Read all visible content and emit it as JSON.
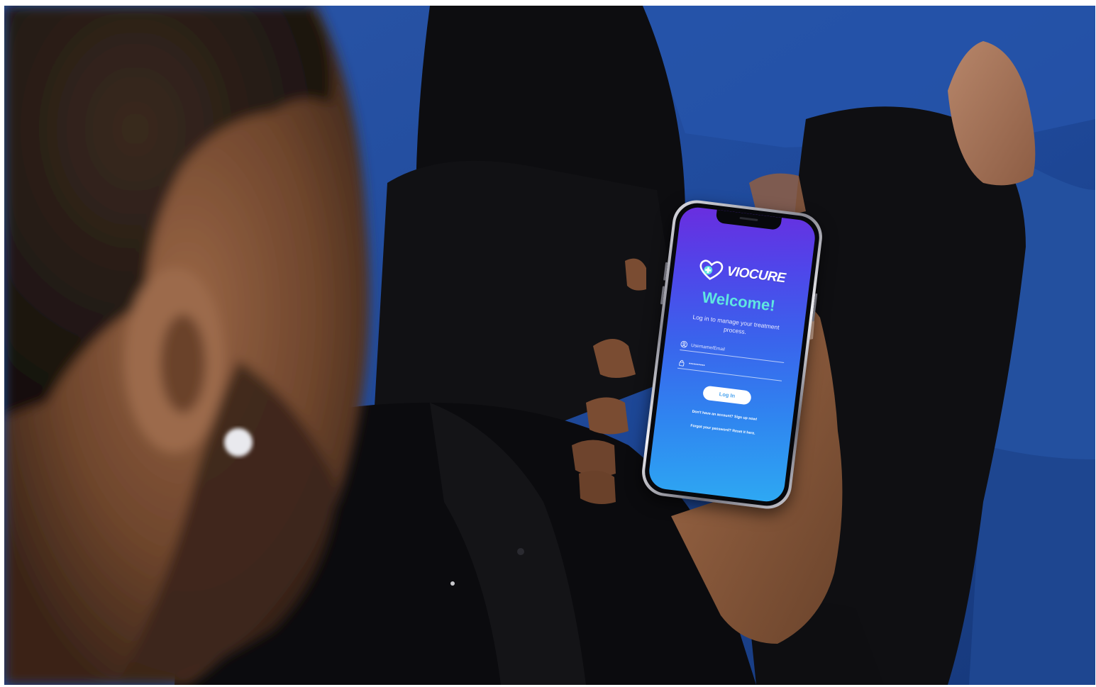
{
  "scene": {
    "colors": {
      "sofa": "#1f4a9c",
      "shirt": "#101012",
      "skin": "#8a5a3c",
      "hair": "#2a1d16"
    }
  },
  "app": {
    "brand": {
      "name": "VIOCURE",
      "logo_icon": "heart-cross-icon"
    },
    "welcome_title": "Welcome!",
    "subtitle": "Log in to manage your treatment process.",
    "username_field": {
      "placeholder": "Username/Email",
      "icon": "user-icon"
    },
    "password_field": {
      "value": "••••••••••",
      "icon": "lock-icon"
    },
    "login_button_label": "Log In",
    "signup_link": "Don't have an account? Sign up now!",
    "reset_link": "Forgot your password? Reset it here.",
    "colors": {
      "gradient_top": "#6a2ddf",
      "gradient_bottom": "#2ea9f3",
      "welcome_text": "#5fe6e0",
      "button_bg": "#ffffff"
    }
  }
}
